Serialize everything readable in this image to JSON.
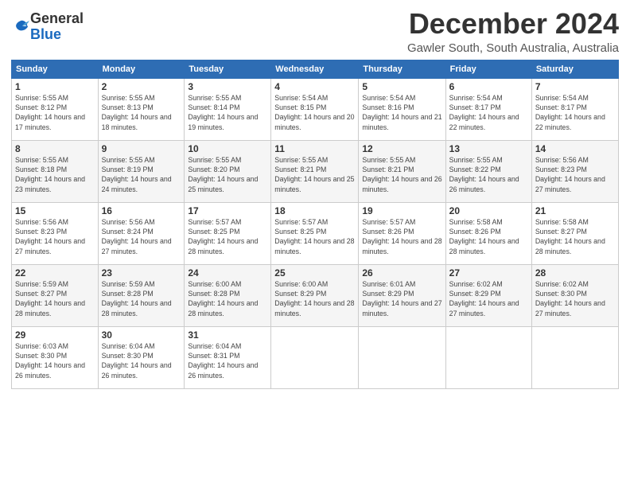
{
  "logo": {
    "general": "General",
    "blue": "Blue"
  },
  "title": "December 2024",
  "location": "Gawler South, South Australia, Australia",
  "days_of_week": [
    "Sunday",
    "Monday",
    "Tuesday",
    "Wednesday",
    "Thursday",
    "Friday",
    "Saturday"
  ],
  "weeks": [
    [
      {
        "day": "1",
        "sunrise": "5:55 AM",
        "sunset": "8:12 PM",
        "daylight": "14 hours and 17 minutes."
      },
      {
        "day": "2",
        "sunrise": "5:55 AM",
        "sunset": "8:13 PM",
        "daylight": "14 hours and 18 minutes."
      },
      {
        "day": "3",
        "sunrise": "5:55 AM",
        "sunset": "8:14 PM",
        "daylight": "14 hours and 19 minutes."
      },
      {
        "day": "4",
        "sunrise": "5:54 AM",
        "sunset": "8:15 PM",
        "daylight": "14 hours and 20 minutes."
      },
      {
        "day": "5",
        "sunrise": "5:54 AM",
        "sunset": "8:16 PM",
        "daylight": "14 hours and 21 minutes."
      },
      {
        "day": "6",
        "sunrise": "5:54 AM",
        "sunset": "8:17 PM",
        "daylight": "14 hours and 22 minutes."
      },
      {
        "day": "7",
        "sunrise": "5:54 AM",
        "sunset": "8:17 PM",
        "daylight": "14 hours and 22 minutes."
      }
    ],
    [
      {
        "day": "8",
        "sunrise": "5:55 AM",
        "sunset": "8:18 PM",
        "daylight": "14 hours and 23 minutes."
      },
      {
        "day": "9",
        "sunrise": "5:55 AM",
        "sunset": "8:19 PM",
        "daylight": "14 hours and 24 minutes."
      },
      {
        "day": "10",
        "sunrise": "5:55 AM",
        "sunset": "8:20 PM",
        "daylight": "14 hours and 25 minutes."
      },
      {
        "day": "11",
        "sunrise": "5:55 AM",
        "sunset": "8:21 PM",
        "daylight": "14 hours and 25 minutes."
      },
      {
        "day": "12",
        "sunrise": "5:55 AM",
        "sunset": "8:21 PM",
        "daylight": "14 hours and 26 minutes."
      },
      {
        "day": "13",
        "sunrise": "5:55 AM",
        "sunset": "8:22 PM",
        "daylight": "14 hours and 26 minutes."
      },
      {
        "day": "14",
        "sunrise": "5:56 AM",
        "sunset": "8:23 PM",
        "daylight": "14 hours and 27 minutes."
      }
    ],
    [
      {
        "day": "15",
        "sunrise": "5:56 AM",
        "sunset": "8:23 PM",
        "daylight": "14 hours and 27 minutes."
      },
      {
        "day": "16",
        "sunrise": "5:56 AM",
        "sunset": "8:24 PM",
        "daylight": "14 hours and 27 minutes."
      },
      {
        "day": "17",
        "sunrise": "5:57 AM",
        "sunset": "8:25 PM",
        "daylight": "14 hours and 28 minutes."
      },
      {
        "day": "18",
        "sunrise": "5:57 AM",
        "sunset": "8:25 PM",
        "daylight": "14 hours and 28 minutes."
      },
      {
        "day": "19",
        "sunrise": "5:57 AM",
        "sunset": "8:26 PM",
        "daylight": "14 hours and 28 minutes."
      },
      {
        "day": "20",
        "sunrise": "5:58 AM",
        "sunset": "8:26 PM",
        "daylight": "14 hours and 28 minutes."
      },
      {
        "day": "21",
        "sunrise": "5:58 AM",
        "sunset": "8:27 PM",
        "daylight": "14 hours and 28 minutes."
      }
    ],
    [
      {
        "day": "22",
        "sunrise": "5:59 AM",
        "sunset": "8:27 PM",
        "daylight": "14 hours and 28 minutes."
      },
      {
        "day": "23",
        "sunrise": "5:59 AM",
        "sunset": "8:28 PM",
        "daylight": "14 hours and 28 minutes."
      },
      {
        "day": "24",
        "sunrise": "6:00 AM",
        "sunset": "8:28 PM",
        "daylight": "14 hours and 28 minutes."
      },
      {
        "day": "25",
        "sunrise": "6:00 AM",
        "sunset": "8:29 PM",
        "daylight": "14 hours and 28 minutes."
      },
      {
        "day": "26",
        "sunrise": "6:01 AM",
        "sunset": "8:29 PM",
        "daylight": "14 hours and 27 minutes."
      },
      {
        "day": "27",
        "sunrise": "6:02 AM",
        "sunset": "8:29 PM",
        "daylight": "14 hours and 27 minutes."
      },
      {
        "day": "28",
        "sunrise": "6:02 AM",
        "sunset": "8:30 PM",
        "daylight": "14 hours and 27 minutes."
      }
    ],
    [
      {
        "day": "29",
        "sunrise": "6:03 AM",
        "sunset": "8:30 PM",
        "daylight": "14 hours and 26 minutes."
      },
      {
        "day": "30",
        "sunrise": "6:04 AM",
        "sunset": "8:30 PM",
        "daylight": "14 hours and 26 minutes."
      },
      {
        "day": "31",
        "sunrise": "6:04 AM",
        "sunset": "8:31 PM",
        "daylight": "14 hours and 26 minutes."
      },
      null,
      null,
      null,
      null
    ]
  ]
}
